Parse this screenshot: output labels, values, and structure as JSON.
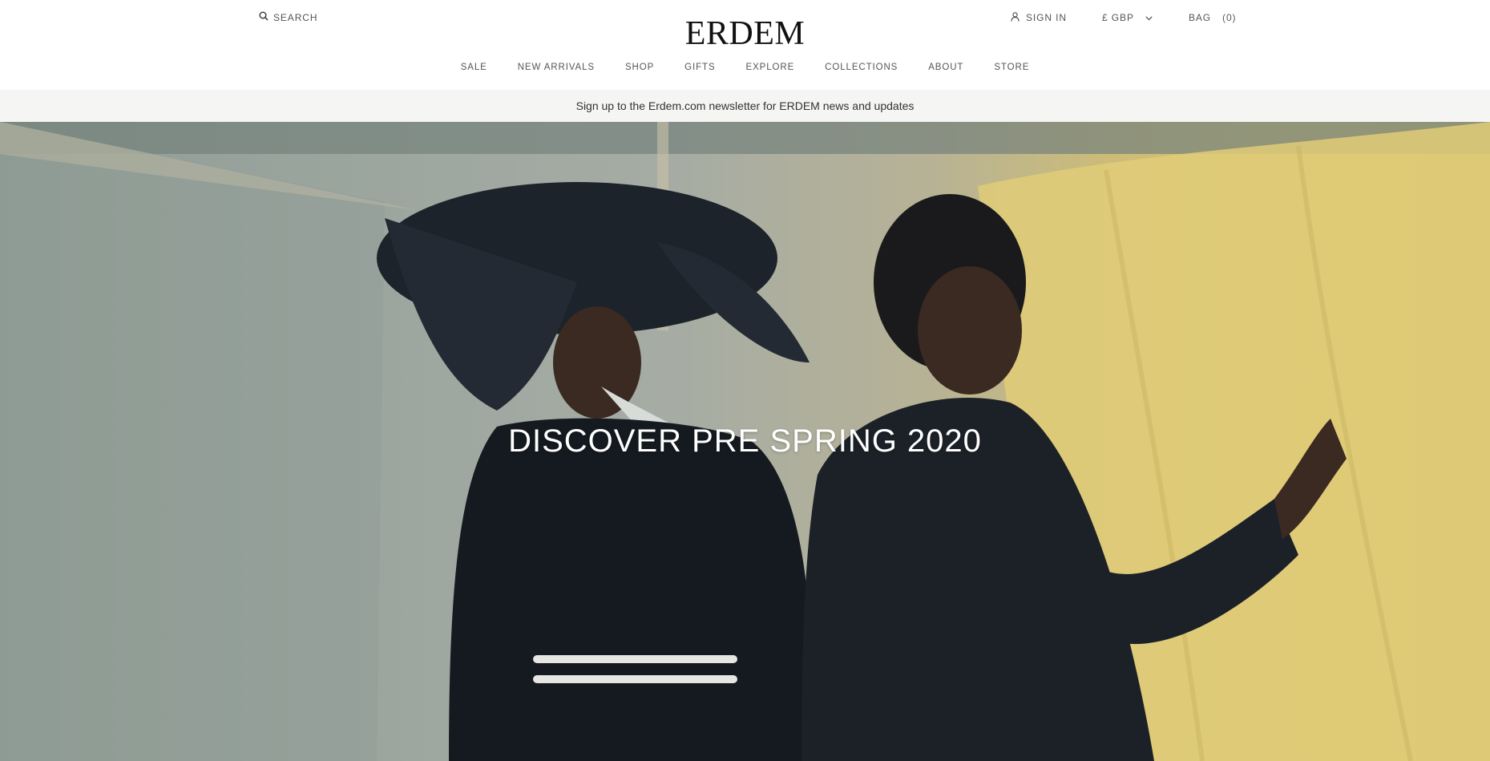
{
  "header": {
    "search_label": "SEARCH",
    "logo": "ERDEM",
    "sign_in_label": "SIGN IN",
    "currency_label": "£ GBP",
    "bag_label": "BAG",
    "bag_count": "(0)"
  },
  "nav": {
    "items": [
      "SALE",
      "NEW ARRIVALS",
      "SHOP",
      "GIFTS",
      "EXPLORE",
      "COLLECTIONS",
      "ABOUT",
      "STORE"
    ]
  },
  "promo": {
    "text": "Sign up to the Erdem.com newsletter for ERDEM news and updates"
  },
  "hero": {
    "title": "DISCOVER PRE SPRING 2020"
  },
  "icons": {
    "search": "search-icon",
    "account": "user-icon",
    "currency_dropdown": "chevron-down-icon"
  },
  "colors": {
    "text": "#555555",
    "logo": "#111111",
    "promo_bg": "#f5f5f4",
    "hero_title": "#ffffff"
  }
}
